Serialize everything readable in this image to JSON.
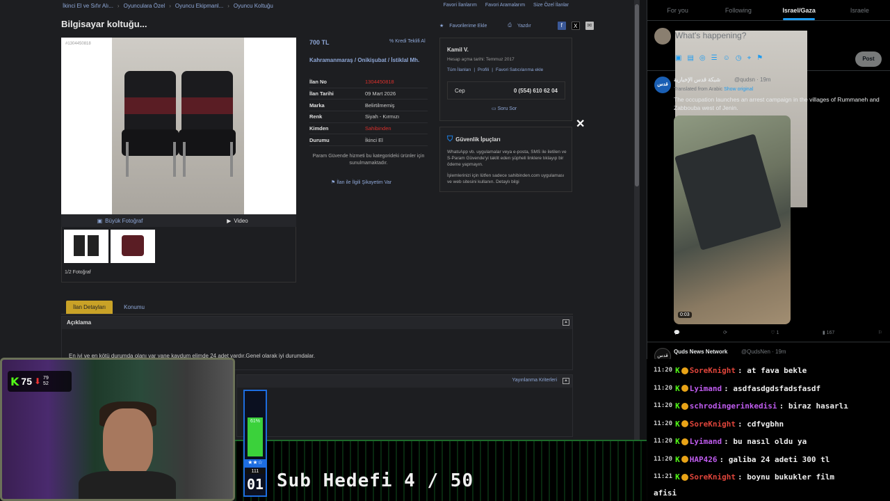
{
  "breadcrumb": [
    "İkinci El ve Sıfır Alı...",
    "Oyunculara Özel",
    "Oyuncu Ekipmanl...",
    "Oyuncu Koltuğu"
  ],
  "toplinks": [
    "Favori İlanlarım",
    "Favori Aramalarım",
    "Size Özel İlanlar"
  ],
  "listing": {
    "title": "Bilgisayar koltuğu...",
    "fav_label": "Favorilerime Ekle",
    "print_label": "Yazdır",
    "photo_id": "#1304450818",
    "photo_tab": "Büyük Fotoğraf",
    "video_tab": "Video",
    "photo_count": "1/2 Fotoğraf",
    "price": "700 TL",
    "kredi": "Kredi Teklifi Al",
    "location": "Kahramanmaraş  /  Onikişubat  /  İstiklal Mh.",
    "details": [
      {
        "k": "İlan No",
        "v": "1304450818",
        "red": true
      },
      {
        "k": "İlan Tarihi",
        "v": "09 Mart 2026",
        "red": false
      },
      {
        "k": "Marka",
        "v": "Belirtilmemiş",
        "red": false
      },
      {
        "k": "Renk",
        "v": "Siyah - Kırmızı",
        "red": false
      },
      {
        "k": "Kimden",
        "v": "Sahibinden",
        "red": true
      },
      {
        "k": "Durumu",
        "v": "İkinci El",
        "red": false
      }
    ],
    "param_text": "Param Güvende hizmeti bu kategorideki ürünler için sunulmamaktadır.",
    "complaint": "İlan ile İlgili Şikayetim Var",
    "tabs": [
      "İlan Detayları",
      "Konumu"
    ],
    "aciklama_title": "Açıklama",
    "aciklama_text": "En iyi ve en kötü durumda olanı var yane kavdum elimde 24 adet vardır.Genel olarak iyi durumdalar.",
    "yayinlanma": "Yayınlanma Kriterleri"
  },
  "seller": {
    "name": "Kamil V.",
    "opened": "Hesap açma tarihi: Temmuz 2017",
    "links": [
      "Tüm İlanları",
      "Profili",
      "Favori Satıcılarıma ekle"
    ],
    "cep_label": "Cep",
    "phone": "0 (554) 610 62 04",
    "ask": "Soru Sor"
  },
  "security": {
    "title": "Güvenlik İpuçları",
    "p1": "WhatsApp vb. uygulamalar veya e-posta, SMS ile iletilen ve S-Param Güvende'yi taklit eden şüpheli linklere tıklayıp bir ödeme yapmayın.",
    "p2": "İşlemlerinizi için lütfen sadece sahibinden.com uygulaması ve web sitesini kullanın. Detaylı bilgi"
  },
  "twitter": {
    "tabs": [
      "For you",
      "Following",
      "Israel/Gaza",
      "Israele"
    ],
    "compose_placeholder": "What's happening?",
    "post": "Post",
    "tweet1": {
      "name": "شبكة قدس الإخبارية",
      "handle": "@qudsn · 19m",
      "translated": "Translated from Arabic",
      "show_original": "Show original",
      "body": "The occupation launches an arrest campaign in the villages of Rummaneh and Zabbouba west of Jenin.",
      "duration": "0:03",
      "likes": "1",
      "views": "167"
    },
    "tweet2": {
      "name": "Quds News Network",
      "handle": "@QudsNen · 19m"
    }
  },
  "chat": [
    {
      "time": "11:20",
      "user": "SoreKnight",
      "color": "#e0453b",
      "msg": "at fava bekle"
    },
    {
      "time": "11:20",
      "user": "Lyimand",
      "color": "#c05cf0",
      "msg": "asdfasdgdsfadsfasdf"
    },
    {
      "time": "11:20",
      "user": "schrodingerinkedisi",
      "color": "#c05cf0",
      "msg": "biraz hasarlı"
    },
    {
      "time": "11:20",
      "user": "SoreKnight",
      "color": "#e0453b",
      "msg": "cdfvgbhn"
    },
    {
      "time": "11:20",
      "user": "Lyimand",
      "color": "#c05cf0",
      "msg": "bu nasıl oldu ya"
    },
    {
      "time": "11:20",
      "user": "HAP426",
      "color": "#c05cf0",
      "msg": "galiba 24 adeti 300 tl"
    },
    {
      "time": "11:21",
      "user": "SoreKnight",
      "color": "#e0453b",
      "msg": "boynu bukukler film"
    }
  ],
  "chat_wrap": "afisi",
  "stream": {
    "viewers": "75",
    "stat1": "79",
    "stat2": "52",
    "meter_pct": "61%",
    "meter_count": "111",
    "meter_num": "01",
    "sub_goal": "Sub Hedefi 4 / 50"
  }
}
